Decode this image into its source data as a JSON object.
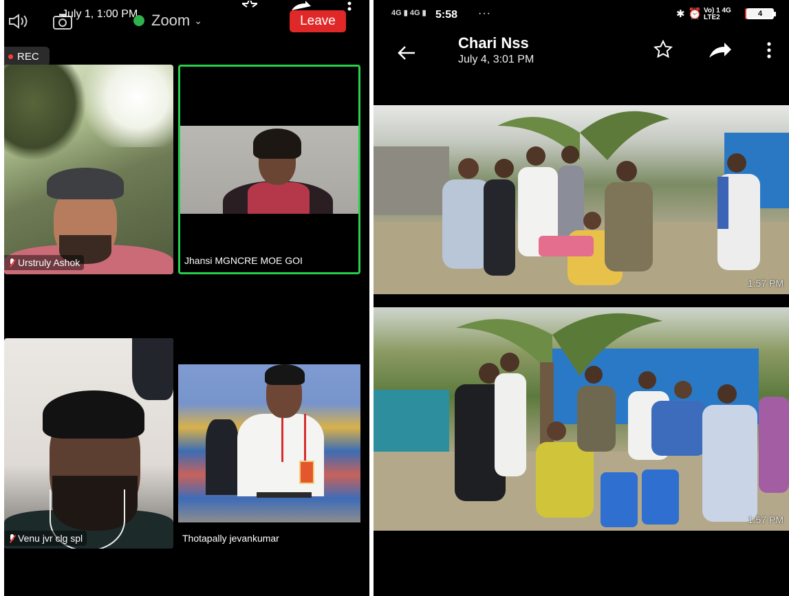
{
  "zoom": {
    "overlay_date": "July 1, 1:00 PM",
    "app_title": "Zoom",
    "leave_label": "Leave",
    "rec_label": "REC",
    "participants": [
      {
        "name": "Urstruly Ashok",
        "muted": true
      },
      {
        "name": "Jhansi MGNCRE MOE GOI",
        "muted": false,
        "active_speaker": true
      },
      {
        "name": "Venu jvr clg spl",
        "muted": true
      },
      {
        "name": "Thotapally jevankumar",
        "muted": false
      }
    ]
  },
  "gallery": {
    "status": {
      "signal_1": "4G",
      "signal_2": "4G",
      "time": "5:58",
      "more": "···",
      "bluetooth": "✱",
      "alarm": "⏰",
      "net_top": "Vo) 1 4G",
      "net_bottom": "LTE2",
      "battery": "4"
    },
    "title": "Chari Nss",
    "subtitle": "July 4, 3:01 PM",
    "photos": [
      {
        "timestamp": "1:57 PM"
      },
      {
        "timestamp": "1:57 PM"
      }
    ]
  },
  "colors": {
    "leave": "#e02828",
    "active_border": "#27d04b",
    "rec_dot": "#ff3b3b"
  }
}
